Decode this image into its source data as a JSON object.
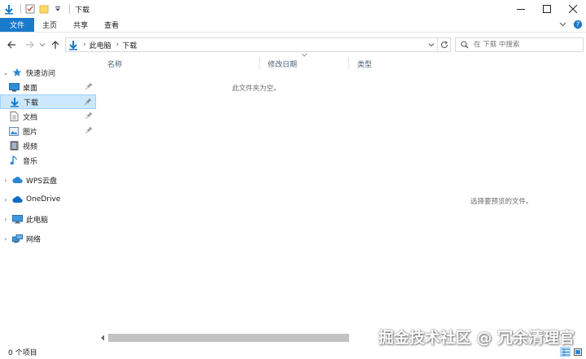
{
  "window": {
    "title": "下载",
    "controls": {
      "minimize": "—",
      "maximize": "☐",
      "close": "✕"
    }
  },
  "ribbon": {
    "tabs": [
      {
        "label": "文件",
        "active": true
      },
      {
        "label": "主页"
      },
      {
        "label": "共享"
      },
      {
        "label": "查看"
      }
    ]
  },
  "address": {
    "crumbs": [
      "此电脑",
      "下载"
    ],
    "search_placeholder": "在 下载 中搜索"
  },
  "nav": {
    "quick_access": "快速访问",
    "items": [
      {
        "label": "桌面",
        "icon": "desktop-icon",
        "pinned": true
      },
      {
        "label": "下载",
        "icon": "download-icon",
        "pinned": true,
        "selected": true
      },
      {
        "label": "文档",
        "icon": "document-icon",
        "pinned": true
      },
      {
        "label": "图片",
        "icon": "picture-icon",
        "pinned": true
      },
      {
        "label": "视频",
        "icon": "video-icon"
      },
      {
        "label": "音乐",
        "icon": "music-icon"
      }
    ],
    "roots": [
      {
        "label": "WPS云盘",
        "icon": "cloud-icon"
      },
      {
        "label": "OneDrive",
        "icon": "onedrive-icon"
      },
      {
        "label": "此电脑",
        "icon": "computer-icon"
      },
      {
        "label": "网络",
        "icon": "network-icon"
      }
    ]
  },
  "content": {
    "columns": [
      "名称",
      "修改日期",
      "类型"
    ],
    "empty_text": "此文件夹为空。",
    "preview_text": "选择要预览的文件。"
  },
  "status": {
    "count": "0 个项目"
  },
  "watermark": "掘金技术社区 @ 冗余清理官",
  "colors": {
    "accent": "#1979ca",
    "selected_bg": "#cce8ff",
    "selected_border": "#99d1ff"
  }
}
